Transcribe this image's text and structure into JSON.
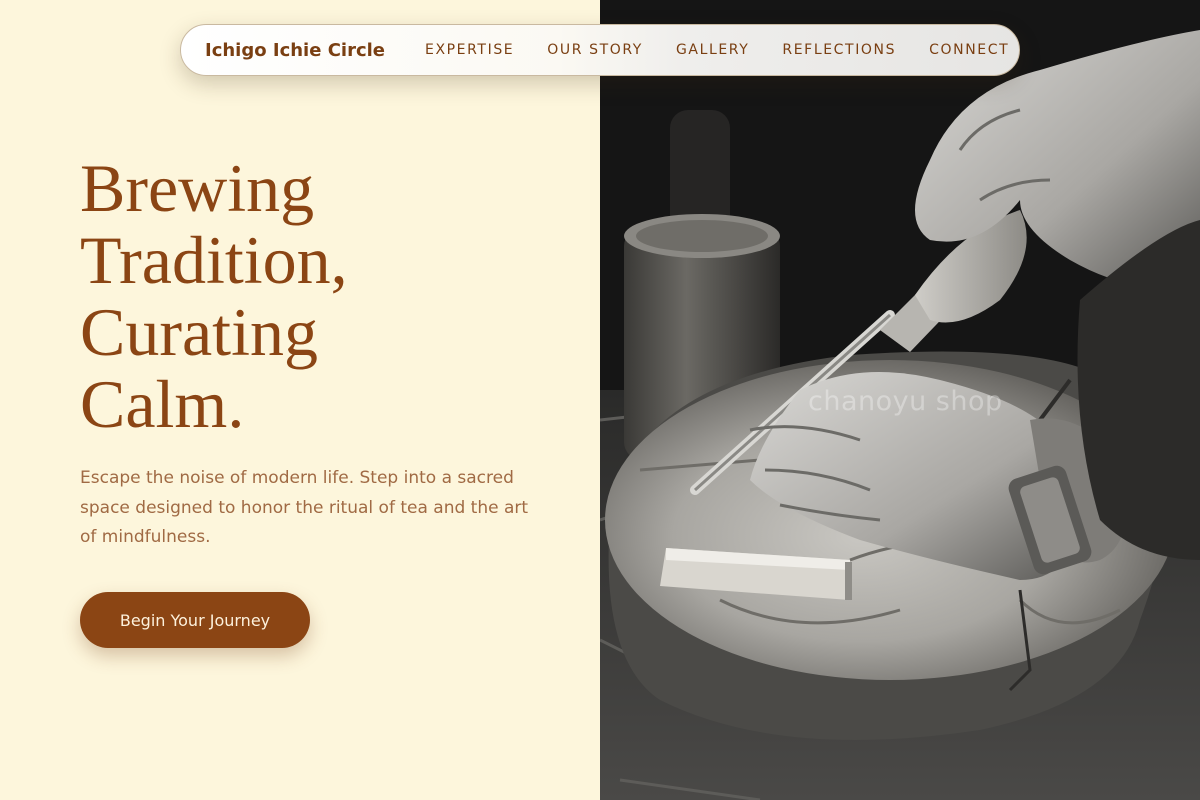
{
  "brand": {
    "name": "Ichigo Ichie Circle"
  },
  "nav": {
    "links": [
      {
        "label": "EXPERTISE"
      },
      {
        "label": "OUR STORY"
      },
      {
        "label": "GALLERY"
      },
      {
        "label": "REFLECTIONS"
      },
      {
        "label": "CONNECT"
      }
    ]
  },
  "hero": {
    "headline_lines": [
      "Brewing",
      "Tradition,",
      "Curating",
      "Calm."
    ],
    "intro": "Escape the noise of modern life. Step into a sacred space designed to honor the ritual of tea and the art of mindfulness.",
    "cta_label": "Begin Your Journey"
  },
  "photo": {
    "watermark": "chanoyu shop"
  },
  "colors": {
    "page_background": "#fdf6dc",
    "accent": "#8b4514",
    "body_text": "#a06a44",
    "photo_background": "#161616"
  }
}
